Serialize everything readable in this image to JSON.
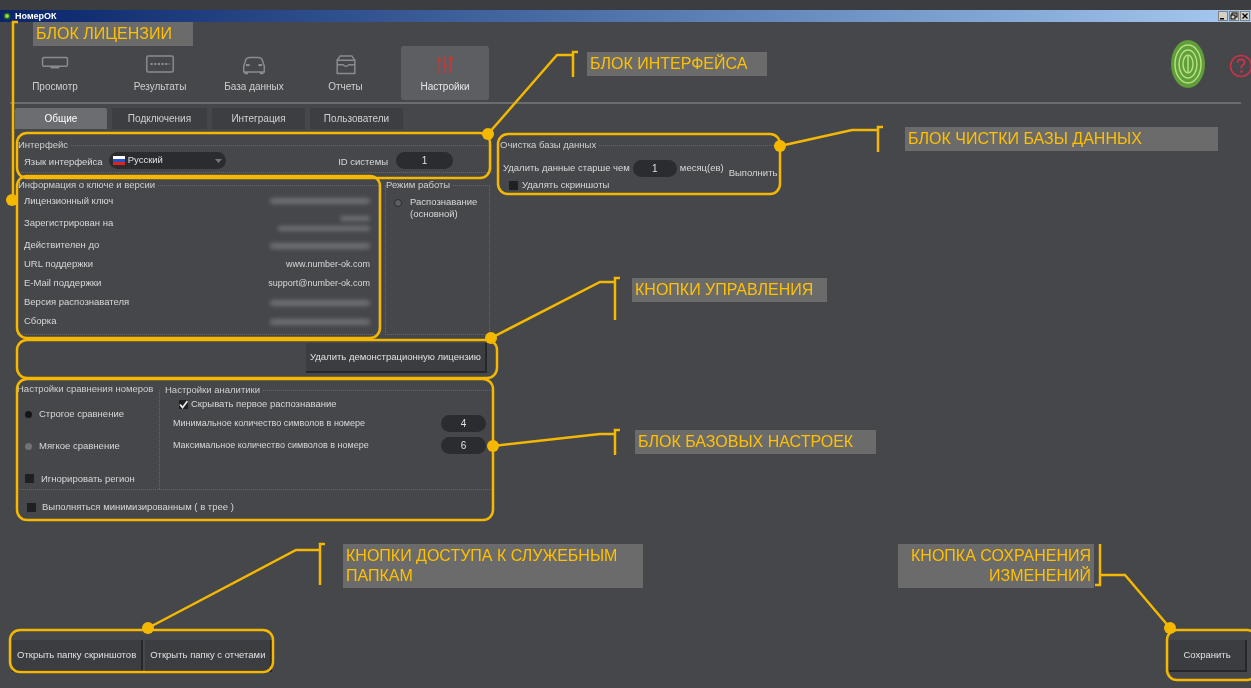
{
  "window": {
    "title": "НомерОК"
  },
  "nav": [
    {
      "label": "Просмотр",
      "selected": false
    },
    {
      "label": "Результаты",
      "selected": false
    },
    {
      "label": "База данных",
      "selected": false
    },
    {
      "label": "Отчеты",
      "selected": false
    },
    {
      "label": "Настройки",
      "selected": true
    }
  ],
  "tabs": [
    {
      "label": "Общие",
      "selected": true
    },
    {
      "label": "Подключения",
      "selected": false
    },
    {
      "label": "Интеграция",
      "selected": false
    },
    {
      "label": "Пользователи",
      "selected": false
    }
  ],
  "interface_group": {
    "title": "Интерфейс",
    "language_label": "Язык интерфейса",
    "language": "Русский",
    "system_id_label": "ID системы",
    "system_id": "1"
  },
  "key_info": {
    "title": "Информация о ключе и версии",
    "rows": [
      {
        "label": "Лицензионный ключ",
        "kind": "blurred"
      },
      {
        "label": "Зарегистрирован на",
        "kind": "blurred2"
      },
      {
        "label": "Действителен до",
        "kind": "blurred"
      },
      {
        "label": "URL поддержки",
        "kind": "text",
        "value": "www.number-ok.com"
      },
      {
        "label": "E-Mail поддержки",
        "kind": "text",
        "value": "support@number-ok.com"
      },
      {
        "label": "Версия распознавателя",
        "kind": "blurred"
      },
      {
        "label": "Сборка",
        "kind": "blurred"
      }
    ]
  },
  "mode": {
    "title": "Режим работы",
    "options": [
      {
        "label": "Распознавание (основной)",
        "selected": false
      }
    ]
  },
  "delete_demo_button": "Удалить демонстрационную лицензию",
  "compare": {
    "title": "Настройки сравнения номеров",
    "options": [
      {
        "kind": "radio",
        "label": "Строгое сравнение",
        "selected": true
      },
      {
        "kind": "radio",
        "label": "Мягкое сравнение",
        "selected": false
      },
      {
        "kind": "checkbox",
        "label": "Игнорировать регион",
        "checked": false
      }
    ]
  },
  "analytics": {
    "title": "Настройки аналитики",
    "hide_first": {
      "label": "Скрывать первое распознавание",
      "checked": true
    },
    "fields": [
      {
        "label": "Минимальное количество символов в номере",
        "value": "4"
      },
      {
        "label": "Максимальное количество символов в номере",
        "value": "6"
      }
    ]
  },
  "run_minimized": {
    "label": "Выполняться минимизированным ( в трее )",
    "checked": false
  },
  "db_cleanup": {
    "title": "Очистка базы данных",
    "delete_label": "Удалить данные старше чем",
    "months": "1",
    "unit": "месяц(ев)",
    "run_button": "Выполнить",
    "delete_screenshots": {
      "label": "Удалять скриншоты",
      "checked": false
    }
  },
  "folder_buttons": [
    "Открыть папку скриншотов",
    "Открыть папку с отчетами"
  ],
  "save_button": "Сохранить",
  "annotations": [
    {
      "text": "БЛОК ЛИЦЕНЗИИ"
    },
    {
      "text": "БЛОК ИНТЕРФЕЙСА"
    },
    {
      "text": "БЛОК ЧИСТКИ БАЗЫ ДАННЫХ"
    },
    {
      "text": "КНОПКИ УПРАВЛЕНИЯ"
    },
    {
      "text": "БЛОК БАЗОВЫХ НАСТРОЕК"
    },
    {
      "text": "КНОПКИ ДОСТУПА К СЛУЖЕБНЫМ ПАПКАМ"
    },
    {
      "text": "КНОПКА СОХРАНЕНИЯ ИЗМЕНЕНИЙ"
    }
  ]
}
